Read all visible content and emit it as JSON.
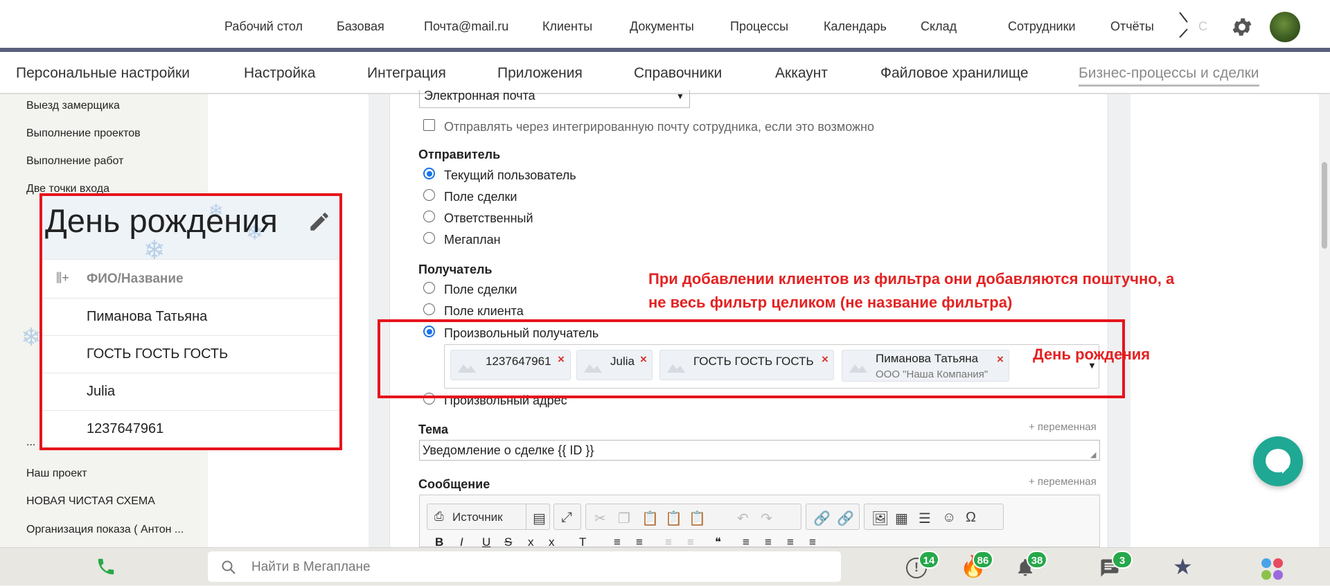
{
  "top_nav": {
    "items": [
      "Рабочий стол",
      "Базовая",
      "Почта@mail.ru",
      "Клиенты",
      "Документы",
      "Процессы",
      "Календарь",
      "Склад",
      "Сотрудники",
      "Отчёты"
    ],
    "overflow_hint": "С"
  },
  "settings_nav": {
    "items": [
      "Персональные настройки",
      "Настройка",
      "Интеграция",
      "Приложения",
      "Справочники",
      "Аккаунт",
      "Файловое хранилище",
      "Бизнес-процессы и сделки"
    ],
    "active": "Бизнес-процессы и сделки"
  },
  "left_list": {
    "items_top": [
      "Выезд замерщика",
      "Выполнение проектов",
      "Выполнение работ",
      "Две точки входа"
    ],
    "items_bottom": [
      "...",
      "Наш проект",
      "НОВАЯ ЧИСТАЯ СХЕМА",
      "Организация показа ( Антон ..."
    ]
  },
  "form": {
    "channel_select": "Электронная почта",
    "send_via_employee_mail": "Отправлять через интегрированную почту сотрудника, если это возможно",
    "sender": {
      "label": "Отправитель",
      "options": [
        "Текущий пользователь",
        "Поле сделки",
        "Ответственный",
        "Мегаплан"
      ],
      "selected": "Текущий пользователь"
    },
    "recipient": {
      "label": "Получатель",
      "options": [
        "Поле сделки",
        "Поле клиента",
        "Произвольный получатель",
        "Произвольный адрес"
      ],
      "selected": "Произвольный получатель",
      "tags": [
        {
          "name": "1237647961",
          "sub": ""
        },
        {
          "name": "Julia",
          "sub": ""
        },
        {
          "name": "ГОСТЬ ГОСТЬ ГОСТЬ",
          "sub": ""
        },
        {
          "name": "Пиманова Татьяна",
          "sub": "ООО \"Наша Компания\""
        }
      ],
      "tag_remove_glyph": "×"
    },
    "subject": {
      "label": "Тема",
      "variable_link": "+ переменная",
      "value": "Уведомление о сделке {{ ID }}"
    },
    "message": {
      "label": "Сообщение",
      "variable_link": "+ переменная",
      "source_button": "Источник"
    }
  },
  "annotations": {
    "note": "При добавлении клиентов из фильтра они добавляются поштучно, а не весь фильтр целиком (не название фильтра)",
    "note_line1": "При добавлении клиентов из фильтра они добавляются поштучно, а",
    "note_line2": "не весь фильтр целиком (не название фильтра)",
    "filter_label": "День рождения",
    "color": "#e32222"
  },
  "birthday_filter_popup": {
    "title": "День рождения",
    "column_header": "ФИО/Название",
    "rows": [
      "Пиманова Татьяна",
      "ГОСТЬ ГОСТЬ ГОСТЬ",
      "Julia",
      "1237647961"
    ]
  },
  "bottom_bar": {
    "search_placeholder": "Найти в Мегаплане",
    "badges": {
      "tasks": "14",
      "deals": "86",
      "notifications": "38",
      "messages": "3"
    }
  },
  "colors": {
    "accent_blue": "#1a73e8",
    "badge_green": "#26a84b",
    "nav_accent_line": "#5a5f7e",
    "chat_button": "#1fa893",
    "remove_red": "#d9322c"
  }
}
